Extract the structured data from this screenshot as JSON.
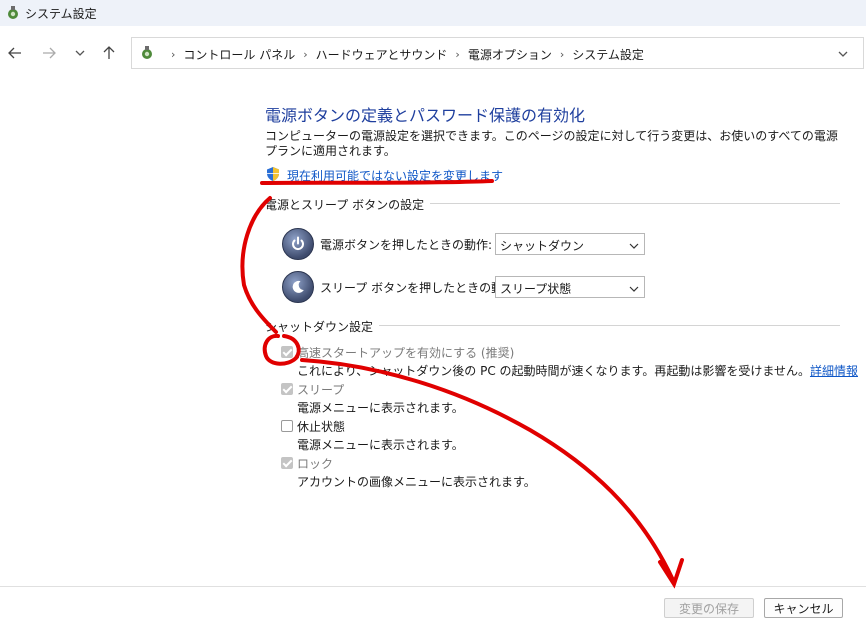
{
  "window": {
    "title": "システム設定"
  },
  "nav": {
    "breadcrumbs": [
      "コントロール パネル",
      "ハードウェアとサウンド",
      "電源オプション",
      "システム設定"
    ]
  },
  "page": {
    "heading": "電源ボタンの定義とパスワード保護の有効化",
    "description": "コンピューターの電源設定を選択できます。このページの設定に対して行う変更は、お使いのすべての電源プランに適用されます。",
    "change_unavailable_link": "現在利用可能ではない設定を変更します"
  },
  "power_buttons": {
    "group_title": "電源とスリープ ボタンの設定",
    "power_label": "電源ボタンを押したときの動作:",
    "power_value": "シャットダウン",
    "sleep_label": "スリープ ボタンを押したときの動作:",
    "sleep_value": "スリープ状態"
  },
  "shutdown": {
    "group_title": "シャットダウン設定",
    "fast_startup": {
      "label": "高速スタートアップを有効にする (推奨)",
      "desc": "これにより、シャットダウン後の PC の起動時間が速くなります。再起動は影響を受けません。",
      "link": "詳細情報",
      "checked": true,
      "disabled": true
    },
    "sleep": {
      "label": "スリープ",
      "desc": "電源メニューに表示されます。",
      "checked": true,
      "disabled": true
    },
    "hibernate": {
      "label": "休止状態",
      "desc": "電源メニューに表示されます。",
      "checked": false,
      "disabled": false
    },
    "lock": {
      "label": "ロック",
      "desc": "アカウントの画像メニューに表示されます。",
      "checked": true,
      "disabled": true
    }
  },
  "footer": {
    "save": "変更の保存",
    "cancel": "キャンセル"
  },
  "colors": {
    "heading": "#1f3f9e",
    "link": "#0f57c7",
    "annotation": "#e00000"
  }
}
